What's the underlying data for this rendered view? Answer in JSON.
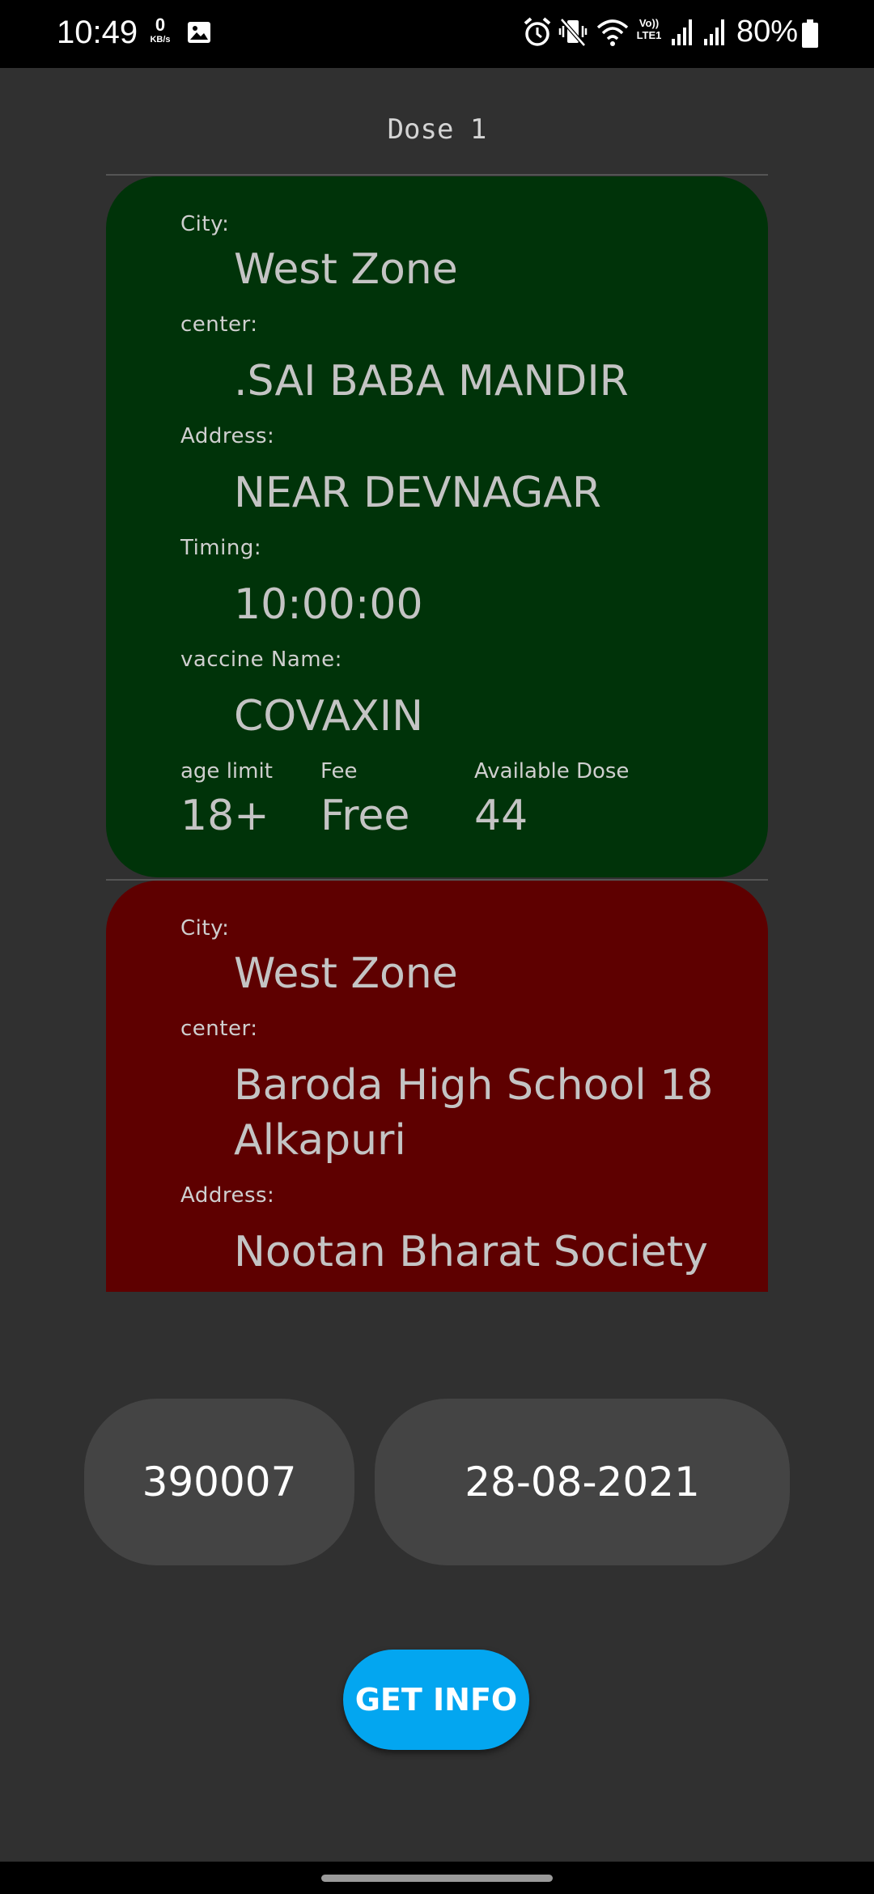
{
  "status_bar": {
    "time": "10:49",
    "net_speed_value": "0",
    "net_speed_unit": "KB/s",
    "volte_line1": "Vo))",
    "volte_line2": "LTE1",
    "battery": "80%",
    "icons": [
      "image-icon",
      "alarm-icon",
      "vibrate-icon",
      "wifi-icon",
      "signal-icon",
      "signal-icon",
      "battery-icon"
    ]
  },
  "dose_title": "Dose 1",
  "centers": [
    {
      "color": "#003309",
      "city_label": "City:",
      "city": "West Zone",
      "center_label": "center:",
      "center": ".SAI BABA MANDIR",
      "address_label": "Address:",
      "address": "NEAR DEVNAGAR",
      "timing_label": "Timing:",
      "timing": "10:00:00",
      "vaccine_label": "vaccine Name:",
      "vaccine": "COVAXIN",
      "age_label": "age limit",
      "age": "18+",
      "fee_label": "Fee",
      "fee": "Free",
      "dose_label": "Available Dose",
      "dose": "44"
    },
    {
      "color": "#5e0000",
      "city_label": "City:",
      "city": "West Zone",
      "center_label": "center:",
      "center_line1": "Baroda High School 18",
      "center_line2": "Alkapuri",
      "address_label": "Address:",
      "address": "Nootan Bharat Society"
    }
  ],
  "inputs": {
    "pincode": "390007",
    "date": "28-08-2021"
  },
  "get_info_label": "GET INFO",
  "colors": {
    "background": "#303030",
    "available_card": "#003309",
    "unavailable_card": "#5e0000",
    "button": "#03a6f0",
    "pill": "#444444"
  }
}
